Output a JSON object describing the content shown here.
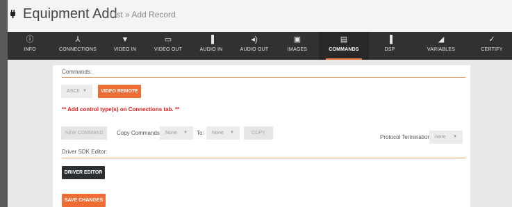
{
  "header": {
    "title": "Equipment Add",
    "breadcrumb": "List » Add Record"
  },
  "tabs": [
    {
      "label": "INFO",
      "icon": "info-icon",
      "glyph": "ⓘ"
    },
    {
      "label": "CONNECTIONS",
      "icon": "connections-icon",
      "glyph": "⅄"
    },
    {
      "label": "VIDEO IN",
      "icon": "video-in-icon",
      "glyph": "▼"
    },
    {
      "label": "VIDEO OUT",
      "icon": "video-out-icon",
      "glyph": "▭"
    },
    {
      "label": "AUDIO IN",
      "icon": "audio-in-icon",
      "glyph": "▐"
    },
    {
      "label": "AUDIO OUT",
      "icon": "audio-out-icon",
      "glyph": "◂)"
    },
    {
      "label": "IMAGES",
      "icon": "images-icon",
      "glyph": "▣"
    },
    {
      "label": "COMMANDS",
      "icon": "commands-icon",
      "glyph": "▤"
    },
    {
      "label": "DSP",
      "icon": "dsp-icon",
      "glyph": "▐"
    },
    {
      "label": "VARIABLES",
      "icon": "variables-icon",
      "glyph": "◢"
    },
    {
      "label": "CERTIFY",
      "icon": "certify-icon",
      "glyph": "✓"
    }
  ],
  "active_tab": "COMMANDS",
  "commands": {
    "section_title": "Commands:",
    "type_select": "ASCII",
    "video_remote": "VIDEO REMOTE",
    "warning": "** Add control type(s) on Connections tab. **",
    "new_command": "NEW COMMAND",
    "copy_label": "Copy Commands:",
    "copy_from": "None",
    "to_label": "To:",
    "copy_to": "None",
    "copy_button": "COPY",
    "termination_label": "Protocol Termination:",
    "termination_value": "none"
  },
  "sdk": {
    "section_title": "Driver SDK Editor:",
    "driver_editor": "DRIVER EDITOR"
  },
  "save_changes": "SAVE CHANGES",
  "colors": {
    "accent": "#ef6c35",
    "tabbar": "#2f3133",
    "warning": "#e31b1b"
  }
}
